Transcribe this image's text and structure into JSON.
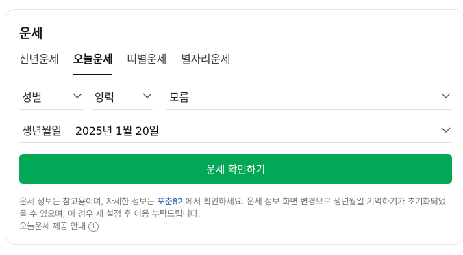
{
  "card": {
    "title": "운세",
    "tabs": [
      {
        "label": "신년운세",
        "active": false
      },
      {
        "label": "오늘운세",
        "active": true
      },
      {
        "label": "띠별운세",
        "active": false
      },
      {
        "label": "별자리운세",
        "active": false
      }
    ],
    "gender_select": {
      "value": "성별"
    },
    "calendar_select": {
      "value": "양력"
    },
    "birth_time_select": {
      "value": "모름"
    },
    "birthdate": {
      "label": "생년월일",
      "value": "2025년 1월 20일"
    },
    "submit_button": "운세 확인하기",
    "notice": {
      "text_before_link": "운세 정보는 참고용이며, 자세한 정보는 ",
      "link_text": "포춘82",
      "text_after_link": " 에서 확인하세요. 운세 정보 화면 변경으로 생년월일 기억하기가 초기화되었을 수 있으며, 이 경우 재 설정 후 이용 부탁드립니다.",
      "info_label": "오늘운세 제공 안내",
      "info_icon": "info-icon"
    }
  },
  "colors": {
    "accent_green": "#03a857",
    "link_blue": "#1f4fb6"
  }
}
